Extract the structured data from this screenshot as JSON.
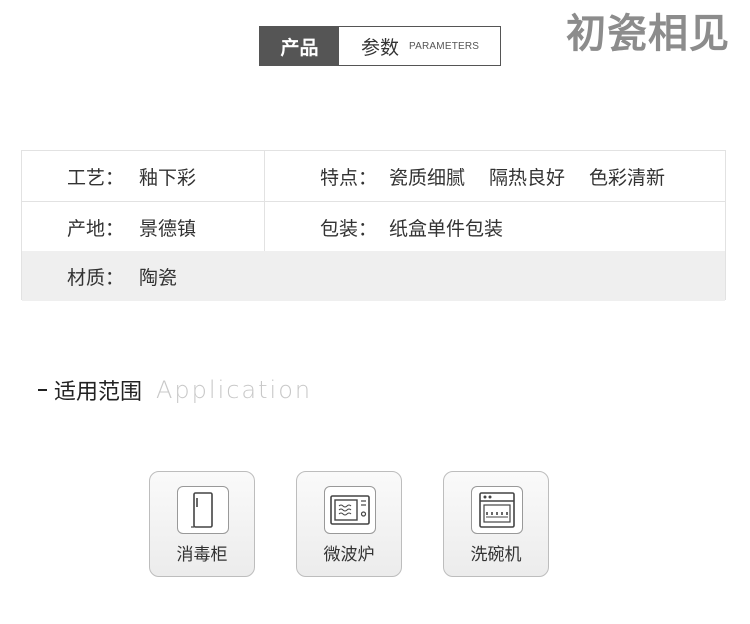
{
  "watermark": "初瓷相见",
  "header": {
    "tab_dark": "产品",
    "tab_light": "参数",
    "tab_sub": "PARAMETERS"
  },
  "specs": {
    "craft_label": "工艺：",
    "craft_value": "釉下彩",
    "features_label": "特点：",
    "features": [
      "瓷质细腻",
      "隔热良好",
      "色彩清新"
    ],
    "origin_label": "产地：",
    "origin_value": "景德镇",
    "package_label": "包装：",
    "package_value": "纸盒单件包装",
    "material_label": "材质：",
    "material_value": "陶瓷"
  },
  "application": {
    "title_cn": "适用范围",
    "title_en": "Application",
    "items": [
      {
        "label": "消毒柜",
        "icon": "sterilizer-cabinet-icon"
      },
      {
        "label": "微波炉",
        "icon": "microwave-icon"
      },
      {
        "label": "洗碗机",
        "icon": "dishwasher-icon"
      }
    ]
  }
}
